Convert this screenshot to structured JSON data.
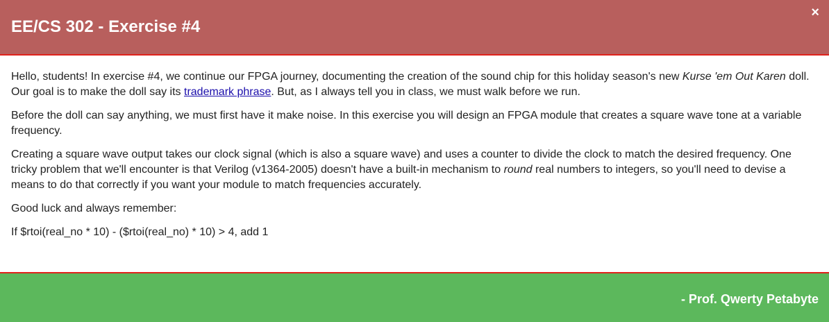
{
  "header": {
    "title": "EE/CS 302 - Exercise #4",
    "close_label": "×"
  },
  "body": {
    "p1": {
      "before_italic": "Hello, students! In exercise #4, we continue our FPGA journey, documenting the creation of the sound chip for this holiday season's new ",
      "italic": "Kurse 'em Out Karen",
      "after_italic": " doll. Our goal is to make the doll say its ",
      "link": "trademark phrase",
      "end": ". But, as I always tell you in class, we must walk before we run."
    },
    "p2": "Before the doll can say anything, we must first have it make noise. In this exercise you will design an FPGA module that creates a square wave tone at a variable frequency.",
    "p3": {
      "before_italic": "Creating a square wave output takes our clock signal (which is also a square wave) and uses a counter to divide the clock to match the desired frequency. One tricky problem that we'll encounter is that Verilog (v1364-2005) doesn't have a built-in mechanism to ",
      "italic": "round",
      "after_italic": " real numbers to integers, so you'll need to devise a means to do that correctly if you want your module to match frequencies accurately."
    },
    "p4": "Good luck and always remember:",
    "p5": "If $rtoi(real_no * 10) - ($rtoi(real_no) * 10) > 4, add 1"
  },
  "footer": {
    "signature": "- Prof. Qwerty Petabyte"
  },
  "colors": {
    "header_bg": "#b85f5d",
    "footer_bg": "#5cb85c",
    "divider": "#e0211b",
    "link": "#1a0dab"
  }
}
